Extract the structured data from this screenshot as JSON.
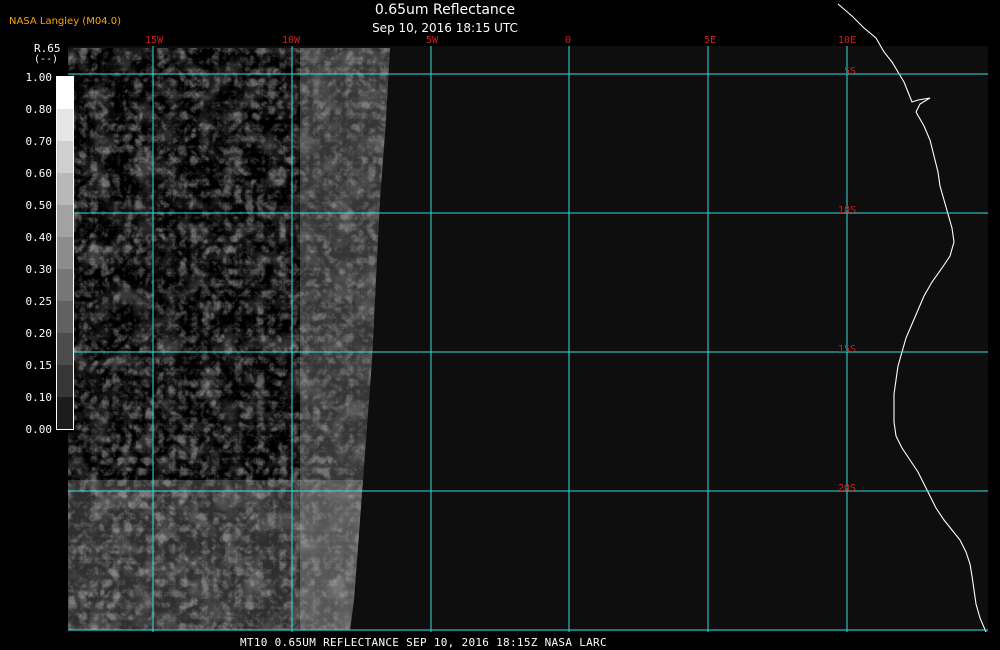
{
  "header": {
    "credit": "NASA Langley (M04.0)",
    "title": "0.65um Reflectance",
    "subtitle": "Sep 10, 2016 18:15 UTC"
  },
  "footer": {
    "caption": "MT10  0.65UM REFLECTANCE   SEP 10, 2016 18:15Z   NASA LARC"
  },
  "legend": {
    "title": "R.65",
    "units": "(--)",
    "ticks": [
      "1.00",
      "0.80",
      "0.70",
      "0.60",
      "0.50",
      "0.40",
      "0.30",
      "0.25",
      "0.20",
      "0.15",
      "0.10",
      "0.00"
    ]
  },
  "map": {
    "lon_labels": [
      "15W",
      "10W",
      "5W",
      "0",
      "5E",
      "10E"
    ],
    "lat_labels": [
      "5S",
      "10S",
      "15S",
      "20S"
    ]
  },
  "colors": {
    "credit": "#ffa500",
    "grid": "#33dddd",
    "grid_label": "#cc2222",
    "coastline": "#ffffff",
    "background": "#0e0e0e"
  }
}
